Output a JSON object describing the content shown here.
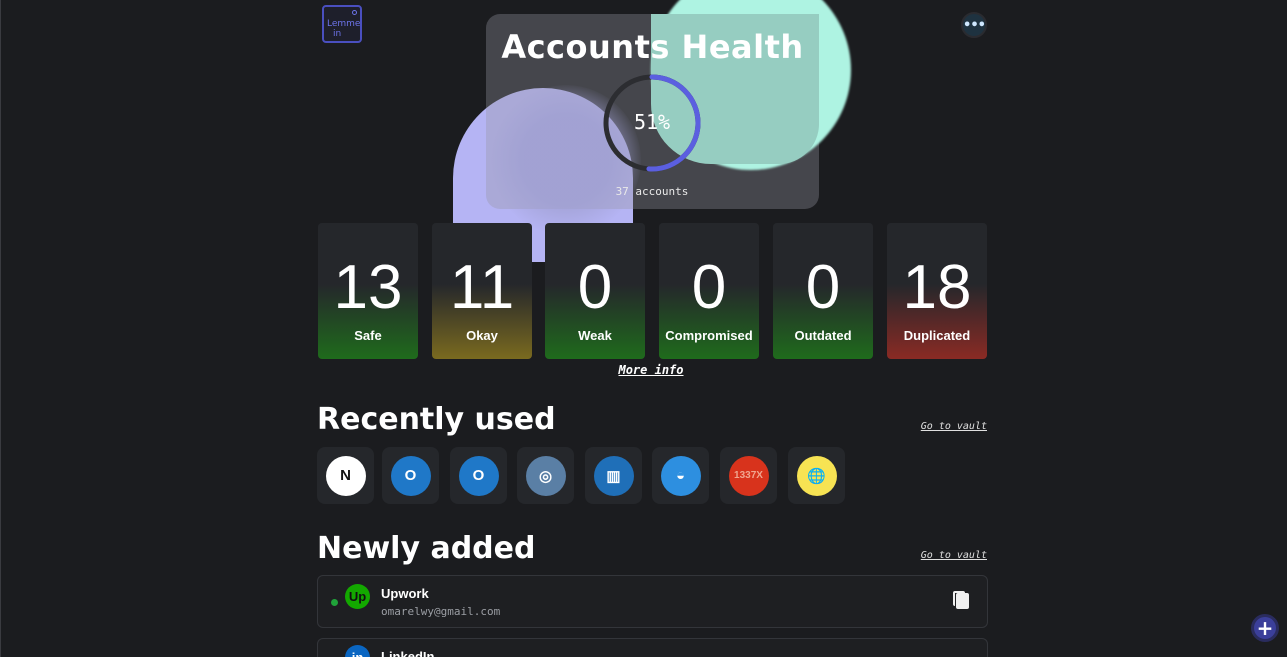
{
  "logo": {
    "text_line1": "Lemme",
    "text_line2": "in"
  },
  "header": {
    "more_icon": "ellipsis-icon"
  },
  "health": {
    "title": "Accounts Health",
    "percent_value": 51,
    "percent_label": "51%",
    "accounts_label": "37 accounts",
    "ring_color": "#5b5fe0"
  },
  "stats": [
    {
      "value": "13",
      "label": "Safe",
      "glow": "#1f6b1c"
    },
    {
      "value": "11",
      "label": "Okay",
      "glow": "#7a6a1f"
    },
    {
      "value": "0",
      "label": "Weak",
      "glow": "#1f6b1c"
    },
    {
      "value": "0",
      "label": "Compromised",
      "glow": "#1f6b1c"
    },
    {
      "value": "0",
      "label": "Outdated",
      "glow": "#1f6b1c"
    },
    {
      "value": "18",
      "label": "Duplicated",
      "glow": "#8a2a24"
    }
  ],
  "more_info": "More info",
  "recently_used": {
    "title": "Recently used",
    "vault_link": "Go to vault",
    "apps": [
      {
        "icon": "notion-icon",
        "glyph": "N",
        "bg": "#ffffff",
        "fg": "#111111"
      },
      {
        "icon": "outlook-icon",
        "glyph": "O",
        "bg": "#1f78c8",
        "fg": "#ffffff"
      },
      {
        "icon": "outlook-icon",
        "glyph": "O",
        "bg": "#1f78c8",
        "fg": "#ffffff"
      },
      {
        "icon": "instagram-icon",
        "glyph": "◎",
        "bg": "#5a7fa5",
        "fg": "#ffffff"
      },
      {
        "icon": "trello-icon",
        "glyph": "▥",
        "bg": "#1f6fb8",
        "fg": "#ffffff"
      },
      {
        "icon": "docker-icon",
        "glyph": "◒",
        "bg": "#2d8fe0",
        "fg": "#ffffff"
      },
      {
        "icon": "1337x-icon",
        "glyph": "1337X",
        "bg": "#d8331c",
        "fg": "#f0a58f"
      },
      {
        "icon": "globe-reader-icon",
        "glyph": "🌐",
        "bg": "#f7e353",
        "fg": "#333333"
      }
    ]
  },
  "newly_added": {
    "title": "Newly added",
    "vault_link": "Go to vault",
    "entries": [
      {
        "name": "Upwork",
        "email": "omarelwy@gmail.com",
        "icon": "upwork-icon",
        "glyph": "Up"
      },
      {
        "name": "LinkedIn",
        "email": "",
        "icon": "linkedin-icon",
        "glyph": "in"
      }
    ]
  },
  "fab": {
    "icon": "plus-icon",
    "glyph": "+"
  }
}
